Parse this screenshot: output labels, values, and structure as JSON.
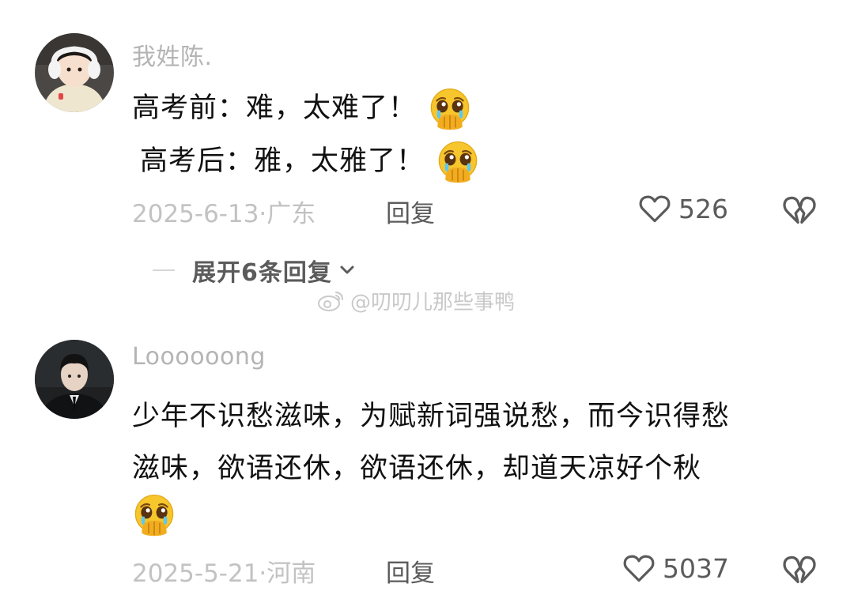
{
  "comments": [
    {
      "username": "我姓陈.",
      "lines": [
        "高考前：难，太难了！",
        "高考后：雅，太雅了！"
      ],
      "date_location": "2025-6-13·广东",
      "reply_label": "回复",
      "like_count": "526",
      "expand_replies": "展开6条回复"
    },
    {
      "username": "Loooooong",
      "lines": [
        "少年不识愁滋味，为赋新词强说愁，而今识得愁",
        "滋味，欲语还休，欲语还休，却道天凉好个秋"
      ],
      "date_location": "2025-5-21·河南",
      "reply_label": "回复",
      "like_count": "5037"
    }
  ],
  "watermark": {
    "text": "@叨叨儿那些事鸭",
    "icon": "weibo-icon"
  },
  "icons": {
    "emoji": "pleading-crying-face-icon",
    "like": "heart-outline-icon",
    "dislike": "broken-heart-icon",
    "expand": "chevron-down-icon"
  },
  "colors": {
    "background": "#ffffff",
    "username": "#b4b4b4",
    "body_text": "#111111",
    "meta_text": "#c2c2c2",
    "action_text": "#5b5b5b"
  }
}
